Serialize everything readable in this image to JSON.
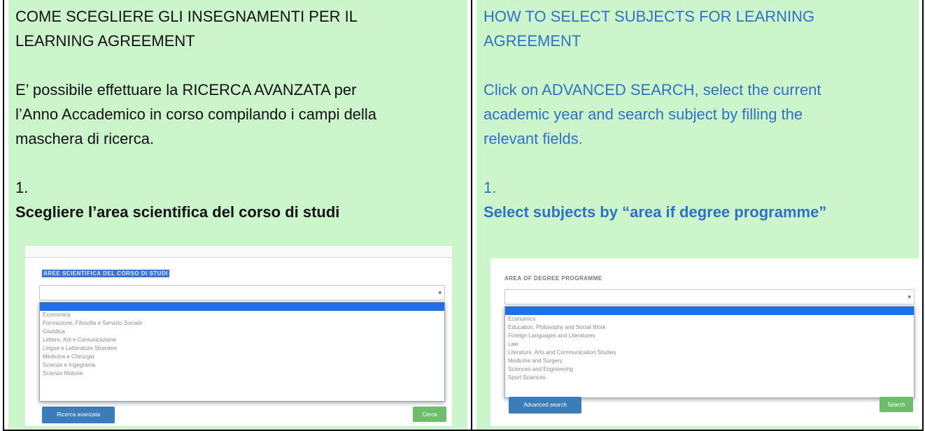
{
  "italian": {
    "title_line1": "COME SCEGLIERE GLI INSEGNAMENTI PER IL",
    "title_line2": "LEARNING AGREEMENT",
    "body_line1": "E’ possibile effettuare la RICERCA AVANZATA per",
    "body_line2": "l’Anno Accademico in corso compilando i campi della",
    "body_line3": "maschera di ricerca.",
    "step_number": "1.",
    "step_text": "Scegliere l’area scientifica del corso di studi",
    "screenshot": {
      "field_label": "AREE SCIENTIFICA DEL CORSO DI STUDI",
      "options": [
        "Economica",
        "Formazione, Filosofia e Servizio Sociale",
        "Giuridica",
        "Lettere, Arti e Comunicazione",
        "Lingue e Letterature Straniere",
        "Medicina e Chirurgia",
        "Scienze e Ingegneria",
        "Scienze Motorie"
      ],
      "advanced_button": "Ricerca avanzata",
      "search_button": "Cerca"
    }
  },
  "english": {
    "title_line1": "HOW TO SELECT SUBJECTS FOR LEARNING",
    "title_line2": "AGREEMENT",
    "body_line1": "Click on ADVANCED SEARCH, select the current",
    "body_line2": "academic year and search subject by filling the",
    "body_line3": "relevant fields.",
    "step_number": "1.",
    "step_text": "Select subjects by “area if degree programme”",
    "screenshot": {
      "field_label": "AREA OF DEGREE PROGRAMME",
      "options": [
        "Economics",
        "Education, Philosophy and Social Work",
        "Foreign Languages and Literatures",
        "Law",
        "Literature, Arts and Communication Studies",
        "Medicine and Surgery",
        "Sciences and Engineering",
        "Sport Sciences"
      ],
      "advanced_button": "Advanced search",
      "search_button": "Search"
    }
  },
  "colors": {
    "cell_background": "#ccf5cc",
    "english_text": "#2f71c5",
    "italian_text": "#111111",
    "dropdown_highlight": "#1f6fe6",
    "advanced_button": "#3c7cb8",
    "search_button": "#6dbd6d"
  }
}
